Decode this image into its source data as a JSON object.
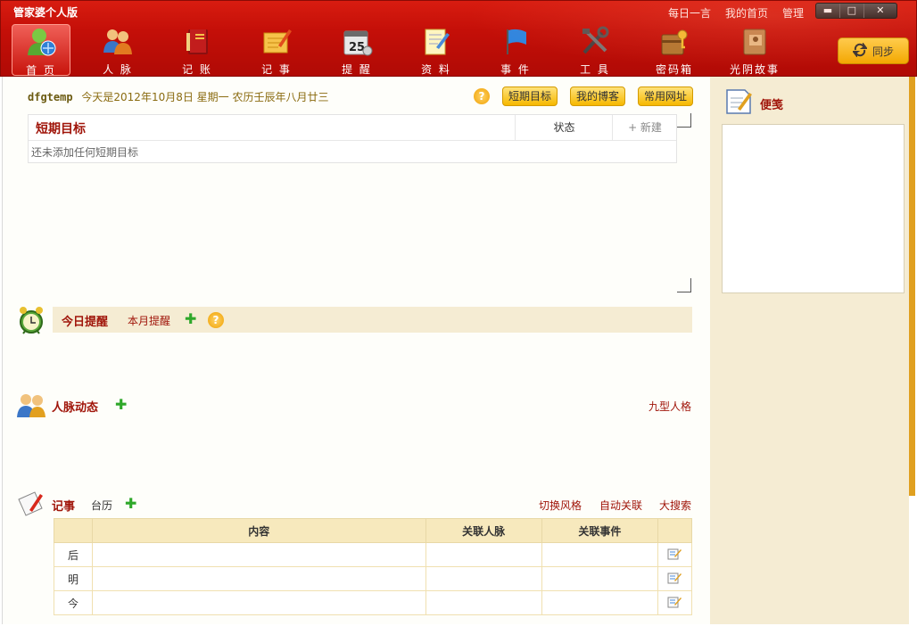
{
  "app": {
    "title": "管家婆个人版"
  },
  "top_links": [
    "每日一言",
    "我的首页",
    "管理"
  ],
  "window_controls": {
    "minimize": "▬",
    "maximize": "□",
    "close": "✕"
  },
  "nav": [
    {
      "label": "首 页",
      "icon": "home-user-icon"
    },
    {
      "label": "人 脉",
      "icon": "contacts-icon"
    },
    {
      "label": "记 账",
      "icon": "account-book-icon"
    },
    {
      "label": "记 事",
      "icon": "notepad-icon"
    },
    {
      "label": "提 醒",
      "icon": "calendar-icon"
    },
    {
      "label": "资 料",
      "icon": "documents-icon"
    },
    {
      "label": "事 件",
      "icon": "flag-icon"
    },
    {
      "label": "工 具",
      "icon": "tools-icon"
    },
    {
      "label": "密码箱",
      "icon": "password-box-icon"
    },
    {
      "label": "光阴故事",
      "icon": "story-book-icon"
    }
  ],
  "calendar_day": "25",
  "sync": {
    "label": "同步"
  },
  "user": {
    "name": "dfgtemp",
    "date_text": "今天是2012年10月8日  星期一  农历壬辰年八月廿三"
  },
  "quick_buttons": [
    "短期目标",
    "我的博客",
    "常用网址"
  ],
  "goals": {
    "title": "短期目标",
    "status_header": "状态",
    "new_label": "+ 新建",
    "empty_text": "还未添加任何短期目标"
  },
  "reminders": {
    "title": "今日提醒",
    "month_link": "本月提醒"
  },
  "contacts": {
    "title": "人脉动态",
    "link": "九型人格"
  },
  "records": {
    "title": "记事",
    "calendar_link": "台历",
    "links": [
      "切换风格",
      "自动关联",
      "大搜索"
    ],
    "columns": [
      "内容",
      "关联人脉",
      "关联事件"
    ],
    "rows": [
      "后",
      "明",
      "今"
    ]
  },
  "notes": {
    "title": "便笺"
  }
}
